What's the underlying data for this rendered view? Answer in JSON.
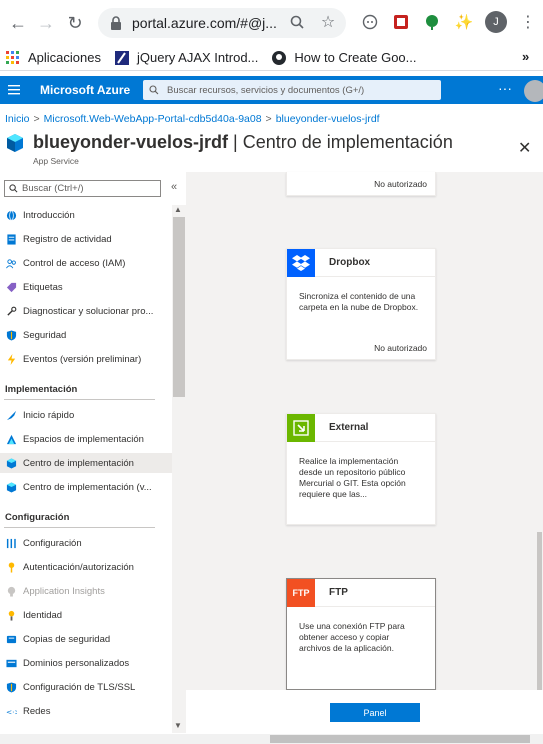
{
  "browser": {
    "url": "portal.azure.com/#@j...",
    "avatar_letter": "J"
  },
  "bookmarks": [
    {
      "label": "Aplicaciones",
      "icon": "apps-grid-icon"
    },
    {
      "label": "jQuery AJAX Introd...",
      "icon": "jquery-icon"
    },
    {
      "label": "How to Create Goo...",
      "icon": "github-icon"
    }
  ],
  "bookmarks_overflow": "»",
  "azure": {
    "brand": "Microsoft Azure",
    "search_placeholder": "Buscar recursos, servicios y documentos (G+/)",
    "more": "···"
  },
  "breadcrumb": [
    "Inicio",
    "Microsoft.Web-WebApp-Portal-cdb5d40a-9a08",
    "blueyonder-vuelos-jrdf"
  ],
  "page": {
    "resource_name": "blueyonder-vuelos-jrdf",
    "separator": " | ",
    "blade_name": "Centro de implementación",
    "subtitle": "App Service"
  },
  "sidebar": {
    "search_placeholder": "Buscar (Ctrl+/)",
    "collapse": "«",
    "items_top": [
      {
        "label": "Introducción",
        "icon": "globe-icon",
        "color": "#0078d4"
      },
      {
        "label": "Registro de actividad",
        "icon": "log-icon",
        "color": "#0078d4"
      },
      {
        "label": "Control de acceso (IAM)",
        "icon": "people-icon",
        "color": "#0078d4"
      },
      {
        "label": "Etiquetas",
        "icon": "tag-icon",
        "color": "#8661c5"
      },
      {
        "label": "Diagnosticar y solucionar pro...",
        "icon": "wrench-icon",
        "color": "#323130"
      },
      {
        "label": "Seguridad",
        "icon": "shield-icon",
        "color": "#0078d4"
      },
      {
        "label": "Eventos (versión preliminar)",
        "icon": "bolt-icon",
        "color": "#ffb900"
      }
    ],
    "section_impl": "Implementación",
    "items_impl": [
      {
        "label": "Inicio rápido",
        "icon": "rocket-icon",
        "color": "#0078d4"
      },
      {
        "label": "Espacios de implementación",
        "icon": "slots-icon",
        "color": "#0078d4"
      },
      {
        "label": "Centro de implementación",
        "icon": "cube-icon",
        "color": "#0078d4",
        "active": true
      },
      {
        "label": "Centro de implementación (v...",
        "icon": "cube-icon",
        "color": "#0078d4"
      }
    ],
    "section_config": "Configuración",
    "items_config": [
      {
        "label": "Configuración",
        "icon": "sliders-icon",
        "color": "#0078d4"
      },
      {
        "label": "Autenticación/autorización",
        "icon": "key-icon",
        "color": "#ffb900"
      },
      {
        "label": "Application Insights",
        "icon": "bulb-icon",
        "color": "#c8c6c4",
        "disabled": true
      },
      {
        "label": "Identidad",
        "icon": "identity-icon",
        "color": "#ffb900"
      },
      {
        "label": "Copias de seguridad",
        "icon": "backup-icon",
        "color": "#0078d4"
      },
      {
        "label": "Dominios personalizados",
        "icon": "domain-icon",
        "color": "#0078d4"
      },
      {
        "label": "Configuración de TLS/SSL",
        "icon": "shield-icon",
        "color": "#0078d4"
      },
      {
        "label": "Redes",
        "icon": "network-icon",
        "color": "#0078d4"
      }
    ]
  },
  "cards": [
    {
      "title": "",
      "description": "",
      "status": "No autorizado"
    },
    {
      "title": "Dropbox",
      "description": "Sincroniza el contenido de una carpeta en la nube de Dropbox.",
      "status": "No autorizado",
      "logo_color": "#0061fe"
    },
    {
      "title": "External",
      "description": "Realice la implementación desde un repositorio público Mercurial o GIT. Esta opción requiere que las...",
      "status": "",
      "logo_color": "#6bb700"
    },
    {
      "title": "FTP",
      "description": "Use una conexión FTP para obtener acceso y copiar archivos de la aplicación.",
      "status": "",
      "logo_color": "#f25022",
      "logo_text": "FTP"
    }
  ],
  "footer": {
    "button": "Panel"
  }
}
